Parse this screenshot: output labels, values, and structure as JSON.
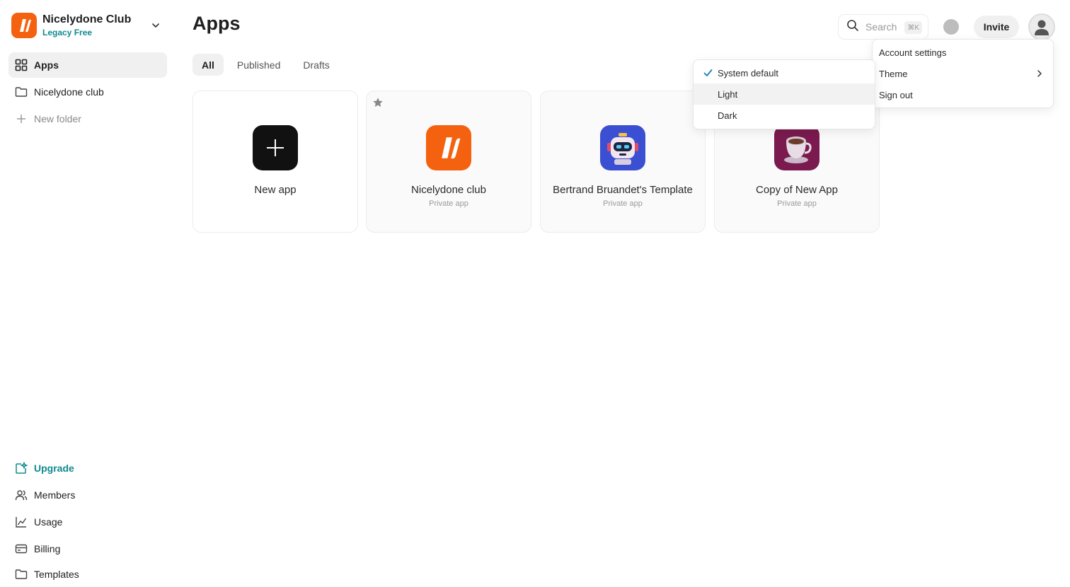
{
  "workspace": {
    "name": "Nicelydone Club",
    "plan": "Legacy Free",
    "icon": "workspace-logo-icon"
  },
  "sidebar": {
    "items": [
      {
        "label": "Apps",
        "icon": "grid-icon"
      },
      {
        "label": "Nicelydone club",
        "icon": "folder-icon"
      },
      {
        "label": "New folder",
        "icon": "plus-icon"
      }
    ],
    "bottom": [
      {
        "label": "Upgrade",
        "icon": "sparkle-icon"
      },
      {
        "label": "Members",
        "icon": "users-icon"
      },
      {
        "label": "Usage",
        "icon": "chart-icon"
      },
      {
        "label": "Billing",
        "icon": "card-icon"
      },
      {
        "label": "Templates",
        "icon": "folder-icon"
      }
    ]
  },
  "header": {
    "title": "Apps",
    "search": {
      "label": "Search",
      "shortcut": "⌘K"
    },
    "invite_label": "Invite"
  },
  "tabs": [
    {
      "label": "All",
      "active": true
    },
    {
      "label": "Published"
    },
    {
      "label": "Drafts"
    }
  ],
  "cards": [
    {
      "title": "New app",
      "subtitle": ""
    },
    {
      "title": "Nicelydone club",
      "subtitle": "Private app",
      "starred": true
    },
    {
      "title": "Bertrand Bruandet's Template",
      "subtitle": "Private app"
    },
    {
      "title": "Copy of New App",
      "subtitle": "Private app"
    }
  ],
  "account_menu": {
    "items": [
      {
        "label": "Account settings"
      },
      {
        "label": "Theme",
        "has_submenu": true
      },
      {
        "label": "Sign out"
      }
    ]
  },
  "theme_menu": {
    "items": [
      {
        "label": "System default",
        "checked": true
      },
      {
        "label": "Light",
        "hovered": true
      },
      {
        "label": "Dark"
      }
    ]
  },
  "colors": {
    "brand": "#f5620f",
    "accent": "#0f8a8f",
    "robot_bg": "#3a4fd1",
    "cup_bg": "#7a1a4e"
  }
}
